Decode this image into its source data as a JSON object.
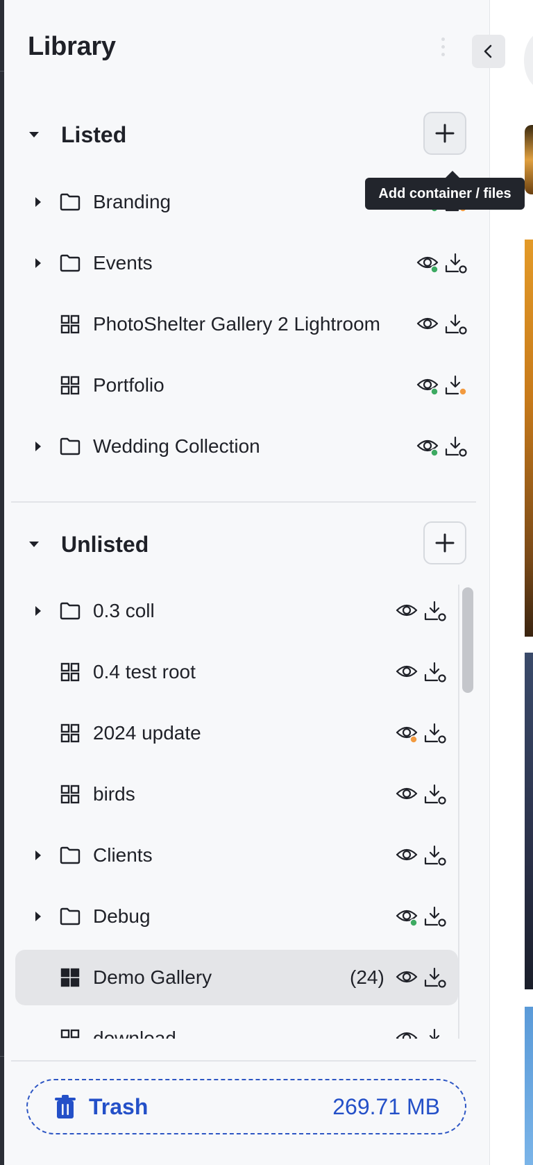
{
  "panel": {
    "title": "Library"
  },
  "tooltip": "Add container / files",
  "colors": {
    "accent": "#2450c8",
    "green_dot": "#3daa62",
    "orange_dot": "#f29a3f",
    "tooltip_bg": "#22252c"
  },
  "listed": {
    "label": "Listed",
    "items": [
      {
        "label": "Branding",
        "icon": "folder-icon",
        "expandable": true,
        "eye_dot": "green",
        "dl_dot": "orange"
      },
      {
        "label": "Events",
        "icon": "folder-icon",
        "expandable": true,
        "eye_dot": "green",
        "dl_dot": "none"
      },
      {
        "label": "PhotoShelter Gallery 2 Lightroom",
        "icon": "gallery-grid-icon",
        "expandable": false,
        "eye_dot": "none",
        "dl_dot": "none"
      },
      {
        "label": "Portfolio",
        "icon": "gallery-grid-icon",
        "expandable": false,
        "eye_dot": "green",
        "dl_dot": "orange"
      },
      {
        "label": "Wedding Collection",
        "icon": "folder-icon",
        "expandable": true,
        "eye_dot": "green",
        "dl_dot": "none"
      }
    ]
  },
  "unlisted": {
    "label": "Unlisted",
    "items": [
      {
        "label": "0.3 coll",
        "icon": "folder-icon",
        "expandable": true,
        "eye_dot": "none",
        "dl_dot": "none"
      },
      {
        "label": "0.4 test root",
        "icon": "gallery-grid-icon",
        "expandable": false,
        "eye_dot": "none",
        "dl_dot": "none"
      },
      {
        "label": "2024 update",
        "icon": "gallery-grid-icon",
        "expandable": false,
        "eye_dot": "orange",
        "dl_dot": "none"
      },
      {
        "label": "birds",
        "icon": "gallery-grid-icon",
        "expandable": false,
        "eye_dot": "none",
        "dl_dot": "none"
      },
      {
        "label": "Clients",
        "icon": "folder-icon",
        "expandable": true,
        "eye_dot": "none",
        "dl_dot": "none"
      },
      {
        "label": "Debug",
        "icon": "folder-icon",
        "expandable": true,
        "eye_dot": "green",
        "dl_dot": "none"
      },
      {
        "label": "Demo Gallery",
        "count": "(24)",
        "icon": "gallery-grid-filled-icon",
        "expandable": false,
        "selected": true,
        "eye_dot": "none",
        "dl_dot": "none"
      },
      {
        "label": "download",
        "icon": "gallery-grid-icon",
        "expandable": false,
        "eye_dot": "none",
        "dl_dot": "none"
      }
    ]
  },
  "trash": {
    "label": "Trash",
    "size": "269.71 MB"
  }
}
